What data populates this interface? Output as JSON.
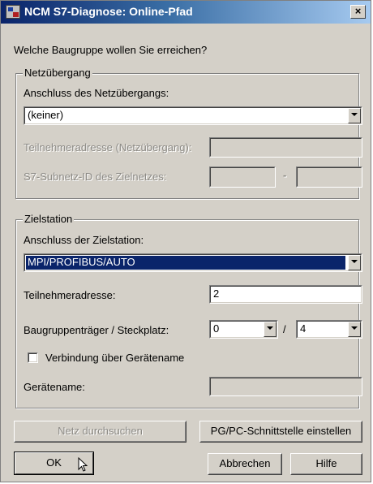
{
  "window": {
    "title": "NCM S7-Diagnose: Online-Pfad",
    "close_glyph": "×"
  },
  "question": "Welche Baugruppe wollen Sie erreichen?",
  "gateway": {
    "legend": "Netzübergang",
    "connection_label": "Anschluss des Netzübergangs:",
    "connection_value": "(keiner)",
    "address_label": "Teilnehmeradresse (Netzübergang):",
    "subnet_label": "S7-Subnetz-ID des Zielnetzes:",
    "subnet_separator": "-"
  },
  "target": {
    "legend": "Zielstation",
    "connection_label": "Anschluss der Zielstation:",
    "connection_value": "MPI/PROFIBUS/AUTO",
    "address_label": "Teilnehmeradresse:",
    "address_value": "2",
    "rack_slot_label": "Baugruppenträger  / Steckplatz:",
    "rack_value": "0",
    "slot_separator": "/",
    "slot_value": "4",
    "device_name_checkbox_label": "Verbindung über Gerätename",
    "device_name_checked": false,
    "device_name_label": "Gerätename:"
  },
  "buttons": {
    "search_network": "Netz durchsuchen",
    "pgpc_interface": "PG/PC-Schnittstelle einstellen",
    "ok": "OK",
    "cancel": "Abbrechen",
    "help": "Hilfe"
  },
  "icons": {
    "dropdown": "chevron-down-icon",
    "app": "app-icon",
    "cursor": "mouse-pointer-icon"
  }
}
